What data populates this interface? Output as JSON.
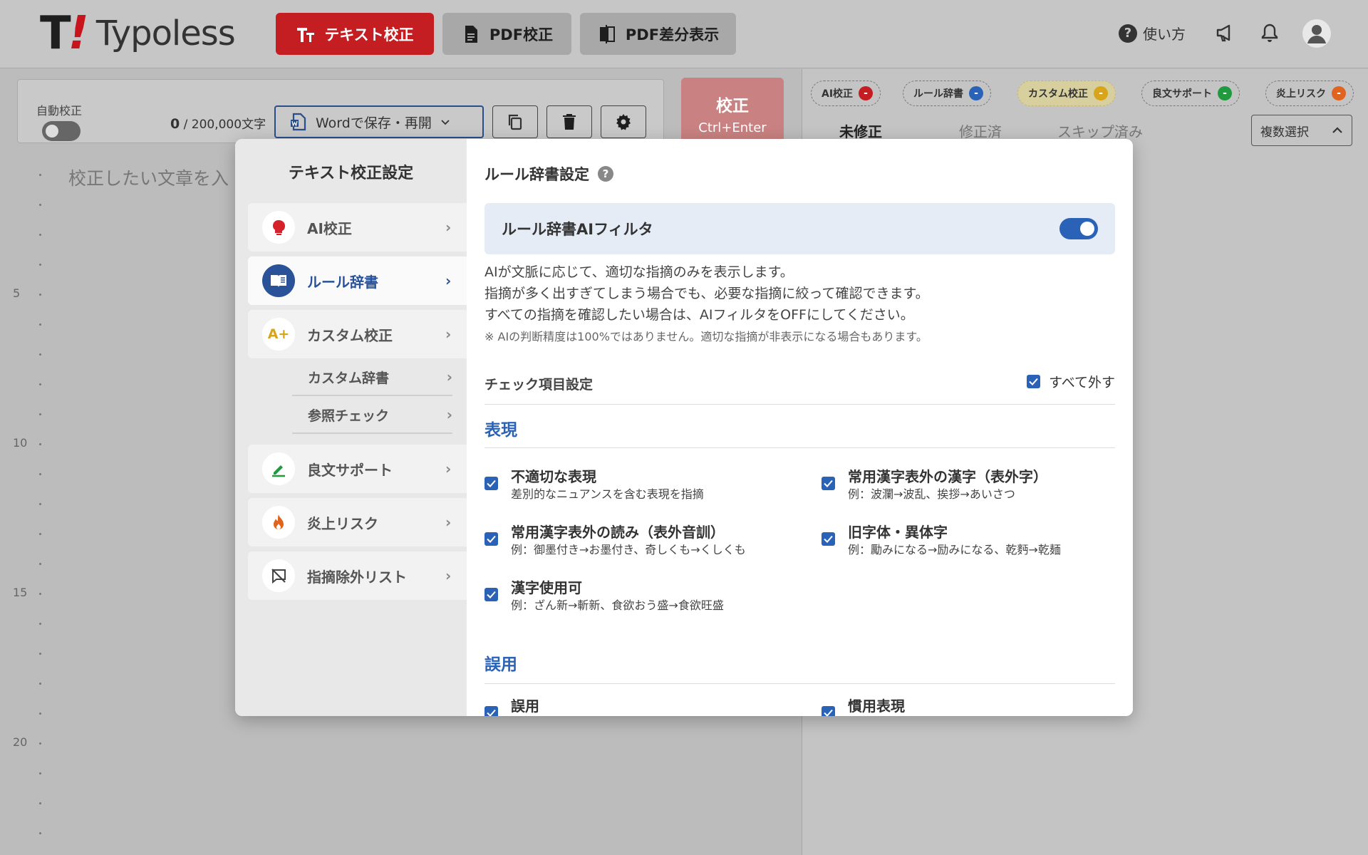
{
  "header": {
    "logo_mark_t": "T",
    "logo_mark_bang": "!",
    "logo_text": "Typoless",
    "btn_text": "テキスト校正",
    "btn_pdf": "PDF校正",
    "btn_diff": "PDF差分表示",
    "help": "使い方"
  },
  "toolbar": {
    "auto_label": "自動校正",
    "count_current": "0",
    "count_total": " / 200,000文字",
    "word_save": "Wordで保存・再開",
    "proof_main": "校正",
    "proof_shortcut": "Ctrl+Enter"
  },
  "editor": {
    "placeholder": "校正したい文章を入",
    "line_numbers": [
      "5",
      "10",
      "15",
      "20"
    ]
  },
  "right": {
    "chips": [
      {
        "label": "AI校正",
        "count": "-",
        "color": "#c41e22"
      },
      {
        "label": "ルール辞書",
        "count": "-",
        "color": "#2a62b8"
      },
      {
        "label": "カスタム校正",
        "count": "-",
        "color": "#d8a51a"
      },
      {
        "label": "良文サポート",
        "count": "-",
        "color": "#1f9a3c"
      },
      {
        "label": "炎上リスク",
        "count": "-",
        "color": "#e0641e"
      }
    ],
    "tabs": [
      "未修正",
      "修正済",
      "スキップ済み"
    ],
    "multi_select": "複数選択"
  },
  "modal": {
    "sidebar_title": "テキスト校正設定",
    "nav": [
      {
        "label": "AI校正"
      },
      {
        "label": "ルール辞書"
      },
      {
        "label": "カスタム校正"
      },
      {
        "label": "良文サポート"
      },
      {
        "label": "炎上リスク"
      },
      {
        "label": "指摘除外リスト"
      }
    ],
    "sub_nav": [
      "カスタム辞書",
      "参照チェック"
    ],
    "title": "ルール辞書設定",
    "filter_label": "ルール辞書AIフィルタ",
    "desc_lines": [
      "AIが文脈に応じて、適切な指摘のみを表示します。",
      "指摘が多く出すぎてしまう場合でも、必要な指摘に絞って確認できます。",
      "すべての指摘を確認したい場合は、AIフィルタをOFFにしてください。"
    ],
    "note": "※ AIの判断精度は100%ではありません。適切な指摘が非表示になる場合もあります。",
    "check_heading": "チェック項目設定",
    "all_off": "すべて外す",
    "section_expression": "表現",
    "options": [
      {
        "title": "不適切な表現",
        "example": "差別的なニュアンスを含む表現を指摘"
      },
      {
        "title": "常用漢字表外の漢字（表外字）",
        "example": "例：波瀾→波乱、挨拶→あいさつ"
      },
      {
        "title": "常用漢字表外の読み（表外音訓）",
        "example": "例：御墨付き→お墨付き、奇しくも→くしくも"
      },
      {
        "title": "旧字体・異体字",
        "example": "例：勵みになる→励みになる、乾麪→乾麺"
      },
      {
        "title": "漢字使用可",
        "example": "例：ざん新→斬新、食欲おう盛→食欲旺盛"
      }
    ],
    "section_misuse": "誤用",
    "misuse_options": [
      {
        "title": "誤用"
      },
      {
        "title": "慣用表現"
      }
    ]
  }
}
